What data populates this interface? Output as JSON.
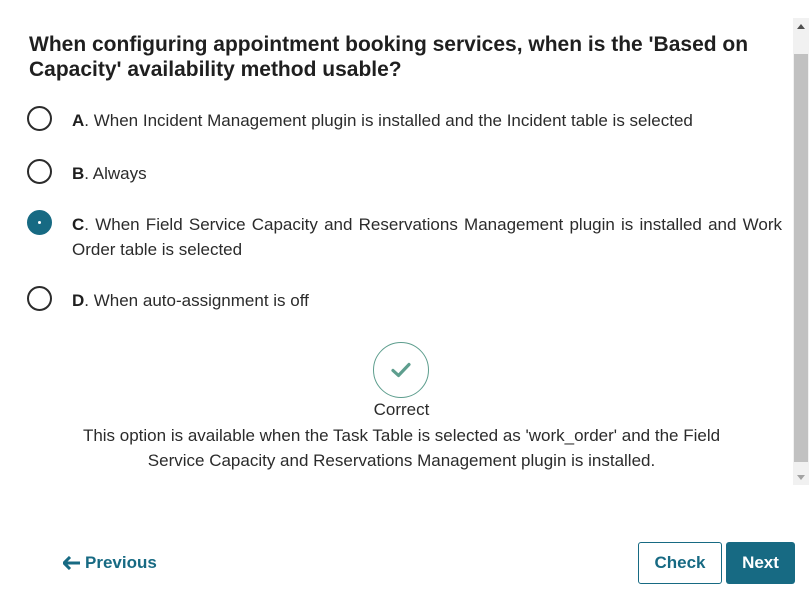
{
  "question": {
    "text": "When configuring appointment booking services, when is the 'Based on Capacity' availability method usable?"
  },
  "options": [
    {
      "letter": "A",
      "text": ". When Incident Management plugin is installed and the Incident table is selected",
      "selected": false
    },
    {
      "letter": "B",
      "text": ". Always",
      "selected": false
    },
    {
      "letter": "C",
      "text": ". When Field Service Capacity and Reservations Management plugin is installed and Work Order table is selected",
      "selected": true
    },
    {
      "letter": "D",
      "text": ". When auto-assignment is off",
      "selected": false
    }
  ],
  "feedback": {
    "icon": "check-icon",
    "title": "Correct",
    "text": "This option is available when the Task Table is selected as 'work_order' and the Field Service Capacity and Reservations Management plugin is installed."
  },
  "navigation": {
    "previous_label": "Previous",
    "check_label": "Check",
    "next_label": "Next"
  },
  "colors": {
    "accent": "#176a83",
    "correct": "#5e9e8e"
  }
}
